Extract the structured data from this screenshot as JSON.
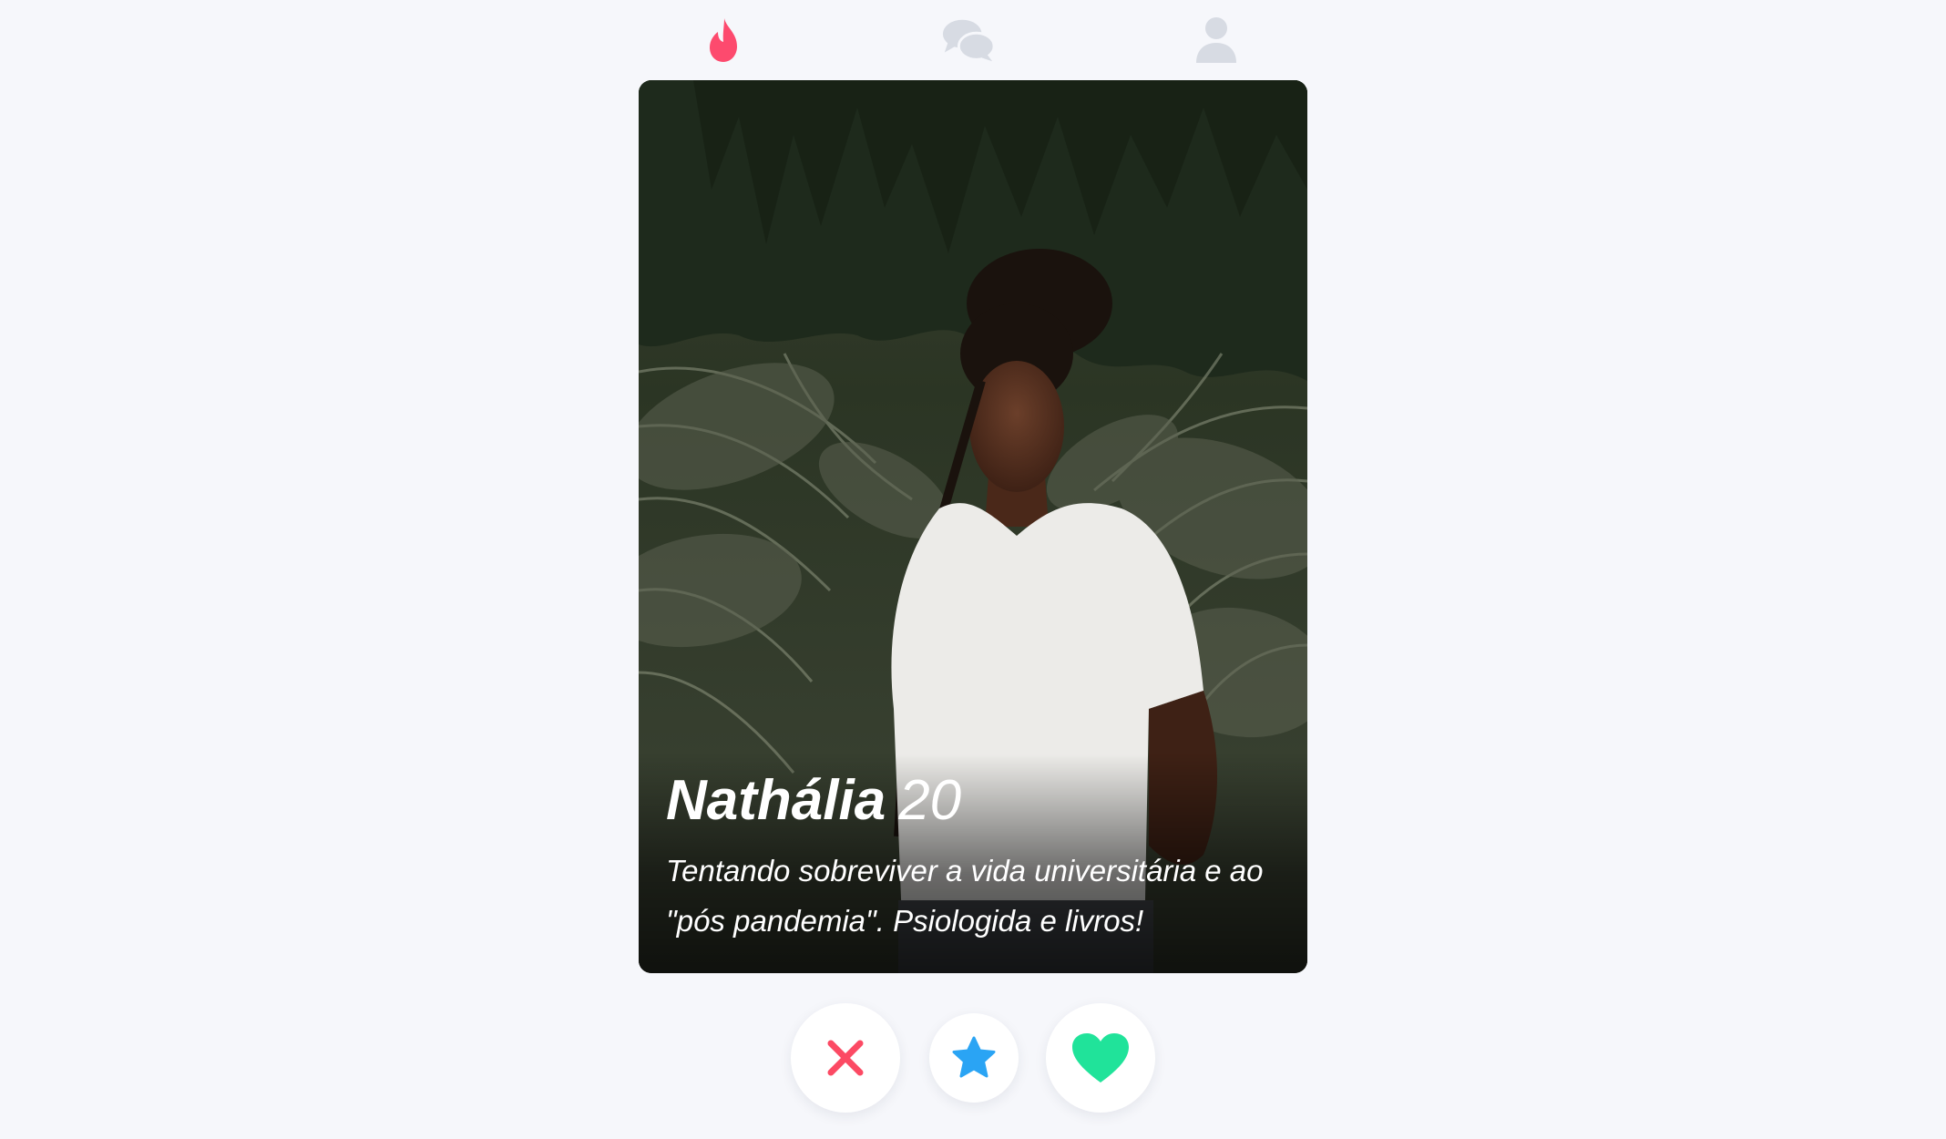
{
  "nav": {
    "items": [
      {
        "name": "flame-icon",
        "active": true,
        "color": "#fd4a6e"
      },
      {
        "name": "chat-bubbles-icon",
        "active": false,
        "color": "#d7dbe3"
      },
      {
        "name": "user-profile-icon",
        "active": false,
        "color": "#d7dbe3"
      }
    ]
  },
  "profile": {
    "name": "Nathália",
    "age": "20",
    "bio": "Tentando sobreviver a vida universitária e ao \"pós pandemia\". Psiologida e livros!"
  },
  "actions": {
    "nope": {
      "icon": "close-x-icon",
      "color": "#fc4a64"
    },
    "superlike": {
      "icon": "star-icon",
      "color": "#2aa4f4"
    },
    "like": {
      "icon": "heart-icon",
      "color": "#20e39a"
    }
  },
  "colors": {
    "background": "#f6f7fb",
    "accent": "#fd4a6e"
  }
}
